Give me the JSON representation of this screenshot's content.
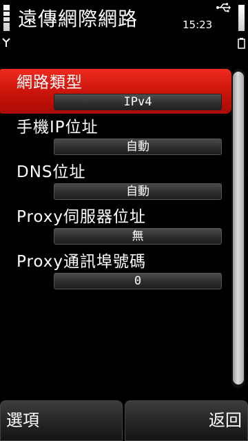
{
  "status": {
    "time": "15:23",
    "signal_icon": "antenna-icon",
    "usb_icon": "usb-icon"
  },
  "title": "遠傳網際網路",
  "settings": [
    {
      "label": "網路類型",
      "value": "IPv4",
      "selected": true
    },
    {
      "label": "手機IP位址",
      "value": "自動",
      "selected": false
    },
    {
      "label": "DNS位址",
      "value": "自動",
      "selected": false
    },
    {
      "label": "Proxy伺服器位址",
      "value": "無",
      "selected": false
    },
    {
      "label": "Proxy通訊埠號碼",
      "value": "0",
      "selected": false
    }
  ],
  "softkeys": {
    "left": "選項",
    "right": "返回"
  },
  "colors": {
    "highlight": "#d81a10",
    "background": "#000000"
  }
}
